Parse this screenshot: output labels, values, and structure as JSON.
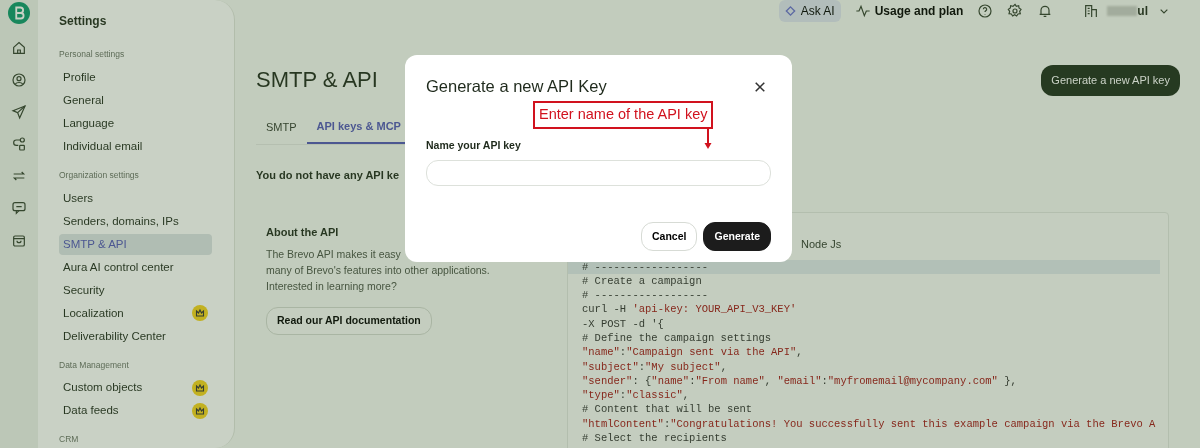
{
  "topbar": {
    "ask_ai": "Ask AI",
    "usage": "Usage and plan",
    "account": "ul"
  },
  "sidebar": {
    "title": "Settings",
    "sections": [
      {
        "heading": "Personal settings",
        "items": [
          {
            "label": "Profile",
            "selected": false,
            "premium": false
          },
          {
            "label": "General",
            "selected": false,
            "premium": false
          },
          {
            "label": "Language",
            "selected": false,
            "premium": false
          },
          {
            "label": "Individual email",
            "selected": false,
            "premium": false
          }
        ]
      },
      {
        "heading": "Organization settings",
        "items": [
          {
            "label": "Users",
            "selected": false,
            "premium": false
          },
          {
            "label": "Senders, domains, IPs",
            "selected": false,
            "premium": false
          },
          {
            "label": "SMTP & API",
            "selected": true,
            "premium": false
          },
          {
            "label": "Aura AI control center",
            "selected": false,
            "premium": false
          },
          {
            "label": "Security",
            "selected": false,
            "premium": false
          },
          {
            "label": "Localization",
            "selected": false,
            "premium": true
          },
          {
            "label": "Deliverability Center",
            "selected": false,
            "premium": false
          }
        ]
      },
      {
        "heading": "Data Management",
        "items": [
          {
            "label": "Custom objects",
            "selected": false,
            "premium": true
          },
          {
            "label": "Data feeds",
            "selected": false,
            "premium": true
          }
        ]
      },
      {
        "heading": "CRM"
      }
    ]
  },
  "page": {
    "title": "SMTP & API",
    "action": "Generate a new API key",
    "tabs": [
      {
        "label": "SMTP",
        "selected": false
      },
      {
        "label": "API keys & MCP",
        "selected": true
      }
    ],
    "empty_message": "You do not have any API ke",
    "about": {
      "heading": "About the API",
      "lines": [
        "The Brevo API makes it easy",
        "many of Brevo's features into other applications.",
        "Interested in learning more?"
      ],
      "button": "Read our API documentation"
    },
    "code_panel": {
      "tabs": [
        {
          "label": "Node Js",
          "selected": false
        }
      ],
      "lines": [
        [
          {
            "t": "# ------------------",
            "kind": "comment"
          }
        ],
        [
          {
            "t": "# Create a campaign",
            "kind": "comment"
          }
        ],
        [
          {
            "t": "# ------------------",
            "kind": "comment"
          }
        ],
        [
          {
            "t": "curl -H ",
            "kind": "plain"
          },
          {
            "t": "'api-key: YOUR_API_V3_KEY'",
            "kind": "string"
          }
        ],
        [
          {
            "t": "-X POST -d '{",
            "kind": "plain"
          }
        ],
        [
          {
            "t": "# Define the campaign settings",
            "kind": "comment"
          }
        ],
        [
          {
            "t": "\"name\"",
            "kind": "string"
          },
          {
            "t": ":",
            "kind": "plain"
          },
          {
            "t": "\"Campaign sent via the API\"",
            "kind": "string"
          },
          {
            "t": ",",
            "kind": "plain"
          }
        ],
        [
          {
            "t": "\"subject\"",
            "kind": "string"
          },
          {
            "t": ":",
            "kind": "plain"
          },
          {
            "t": "\"My subject\"",
            "kind": "string"
          },
          {
            "t": ",",
            "kind": "plain"
          }
        ],
        [
          {
            "t": "\"sender\"",
            "kind": "string"
          },
          {
            "t": ": {",
            "kind": "plain"
          },
          {
            "t": "\"name\"",
            "kind": "string"
          },
          {
            "t": ":",
            "kind": "plain"
          },
          {
            "t": "\"From name\"",
            "kind": "string"
          },
          {
            "t": ", ",
            "kind": "plain"
          },
          {
            "t": "\"email\"",
            "kind": "string"
          },
          {
            "t": ":",
            "kind": "plain"
          },
          {
            "t": "\"myfromemail@mycompany.com\"",
            "kind": "string"
          },
          {
            "t": " },",
            "kind": "plain"
          }
        ],
        [
          {
            "t": "\"type\"",
            "kind": "string"
          },
          {
            "t": ":",
            "kind": "plain"
          },
          {
            "t": "\"classic\"",
            "kind": "string"
          },
          {
            "t": ",",
            "kind": "plain"
          }
        ],
        [
          {
            "t": "# Content that will be sent",
            "kind": "comment"
          }
        ],
        [
          {
            "t": "\"htmlContent\"",
            "kind": "string"
          },
          {
            "t": ":",
            "kind": "plain"
          },
          {
            "t": "\"Congratulations! You successfully sent this example campaign via the Brevo A",
            "kind": "string"
          }
        ],
        [
          {
            "t": "# Select the recipients",
            "kind": "comment"
          }
        ]
      ]
    }
  },
  "modal": {
    "title": "Generate a new API Key",
    "label": "Name your API key",
    "buttons": [
      {
        "label": "Cancel",
        "kind": "secondary"
      },
      {
        "label": "Generate",
        "kind": "primary"
      }
    ],
    "annotation": "Enter name of the API key"
  }
}
